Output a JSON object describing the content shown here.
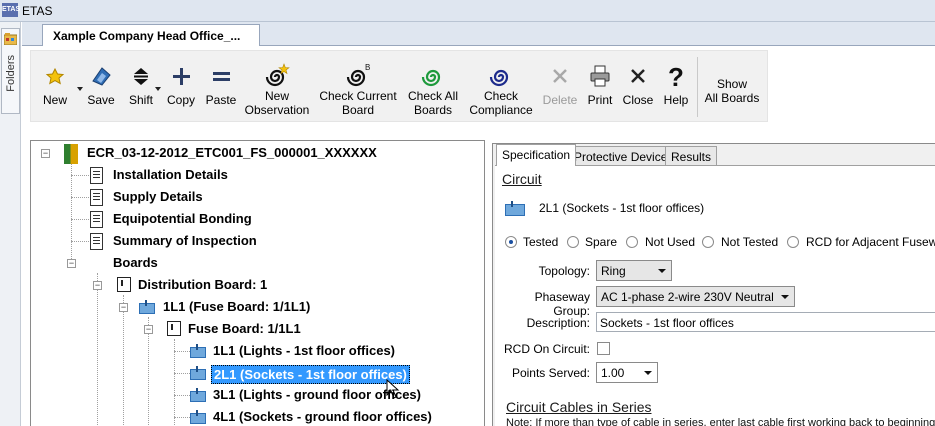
{
  "window": {
    "title": "ETAS",
    "app_icon_text": "ETAS"
  },
  "folders": {
    "label": "Folders"
  },
  "document_tab": {
    "label": "Xample Company Head Office_..."
  },
  "toolbar": {
    "new": "New",
    "save": "Save",
    "shift": "Shift",
    "copy": "Copy",
    "paste": "Paste",
    "new_observation": [
      "New",
      "Observation"
    ],
    "check_current_board": [
      "Check Current",
      "Board"
    ],
    "check_all_boards": [
      "Check All",
      "Boards"
    ],
    "check_compliance": [
      "Check",
      "Compliance"
    ],
    "delete": "Delete",
    "print": "Print",
    "close": "Close",
    "help": "Help",
    "show_all_boards": [
      "Show",
      "All Boards"
    ]
  },
  "tree": {
    "root": "ECR_03-12-2012_ETC001_FS_000001_XXXXXX",
    "items": [
      "Installation Details",
      "Supply Details",
      "Equipotential Bonding",
      "Summary of Inspection",
      "Boards"
    ],
    "distribution_board": "Distribution Board: 1",
    "fuse_node": "1L1 (Fuse Board: 1/1L1)",
    "fuse_board": "Fuse Board: 1/1L1",
    "circuits": [
      "1L1 (Lights - 1st floor offices)",
      "2L1 (Sockets - 1st floor offices)",
      "3L1 (Lights - ground floor offices)",
      "4L1 (Sockets - ground floor offices)"
    ]
  },
  "right_panel": {
    "tabs": [
      "Specification",
      "Protective Device",
      "Results"
    ],
    "section_circuit": "Circuit",
    "circuit_name": "2L1 (Sockets - 1st floor offices)",
    "status_options": [
      "Tested",
      "Spare",
      "Not Used",
      "Not Tested",
      "RCD for Adjacent Fuseway"
    ],
    "selected_status": "Tested",
    "topology_label": "Topology:",
    "topology_value": "Ring",
    "phaseway_label": "Phaseway Group:",
    "phaseway_value": "AC 1-phase 2-wire 230V Neutral",
    "description_label": "Description:",
    "description_value": "Sockets - 1st floor offices",
    "rcd_label": "RCD On Circuit:",
    "rcd_checked": false,
    "points_label": "Points Served:",
    "points_value": "1.00",
    "section_cables": "Circuit Cables in Series",
    "cables_note": "Note: If more than type of cable in series, enter last cable first working back to beginning of"
  }
}
